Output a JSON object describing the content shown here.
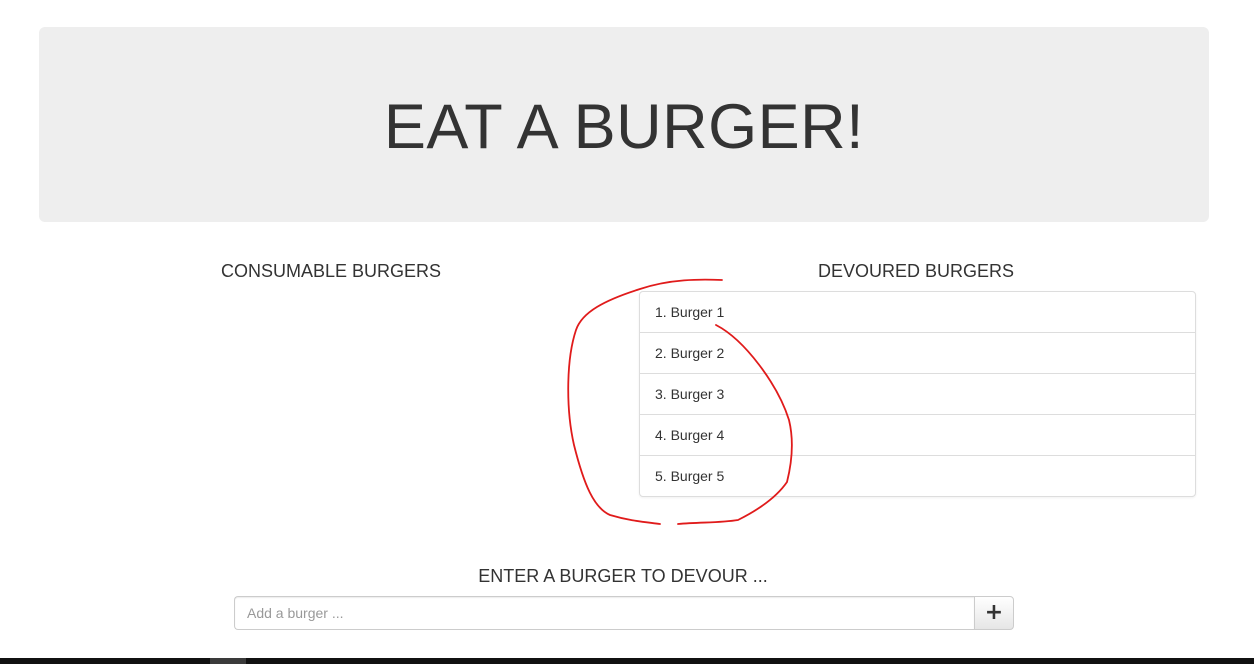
{
  "header": {
    "title": "EAT A BURGER!"
  },
  "consumable": {
    "heading": "CONSUMABLE BURGERS",
    "items": []
  },
  "devoured": {
    "heading": "DEVOURED BURGERS",
    "items": [
      {
        "label": "1. Burger 1"
      },
      {
        "label": "2. Burger 2"
      },
      {
        "label": "3. Burger 3"
      },
      {
        "label": "4. Burger 4"
      },
      {
        "label": "5. Burger 5"
      }
    ]
  },
  "form": {
    "heading": "ENTER A BURGER TO DEVOUR ...",
    "placeholder": "Add a burger ...",
    "value": "",
    "add_icon": "plus-icon",
    "add_glyph": "+"
  },
  "annotation": {
    "description": "red hand-drawn circle",
    "color": "#e01b1b"
  },
  "colors": {
    "jumbotron_bg": "#eeeeee",
    "text": "#333333",
    "border": "#dddddd"
  }
}
